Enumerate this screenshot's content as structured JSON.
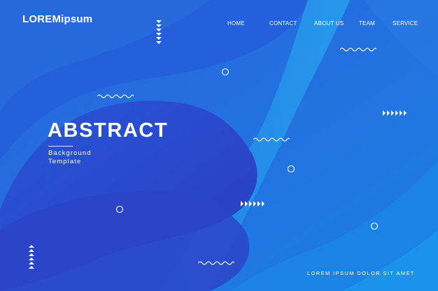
{
  "brand": {
    "name": "LOREMipsum"
  },
  "nav": {
    "items": [
      {
        "label": "HOME"
      },
      {
        "label": "CONTACT"
      },
      {
        "label": "ABOUT US"
      },
      {
        "label": "TEAM"
      },
      {
        "label": "SERVICE"
      }
    ]
  },
  "hero": {
    "title": "ABSTRACT",
    "subtitle_line1": "Background",
    "subtitle_line2": "Template"
  },
  "footer": {
    "text": "LOREM IPSUM DOLOR SIT AMET"
  },
  "colors": {
    "background": "#1e5fd8",
    "wave_dark": "#2a3fc4",
    "wave_light": "#1a8fe6",
    "text": "#ffffff"
  },
  "decorations": {
    "icons": [
      "zigzag-icon",
      "triangle-arrows-icon",
      "ring-icon"
    ]
  }
}
